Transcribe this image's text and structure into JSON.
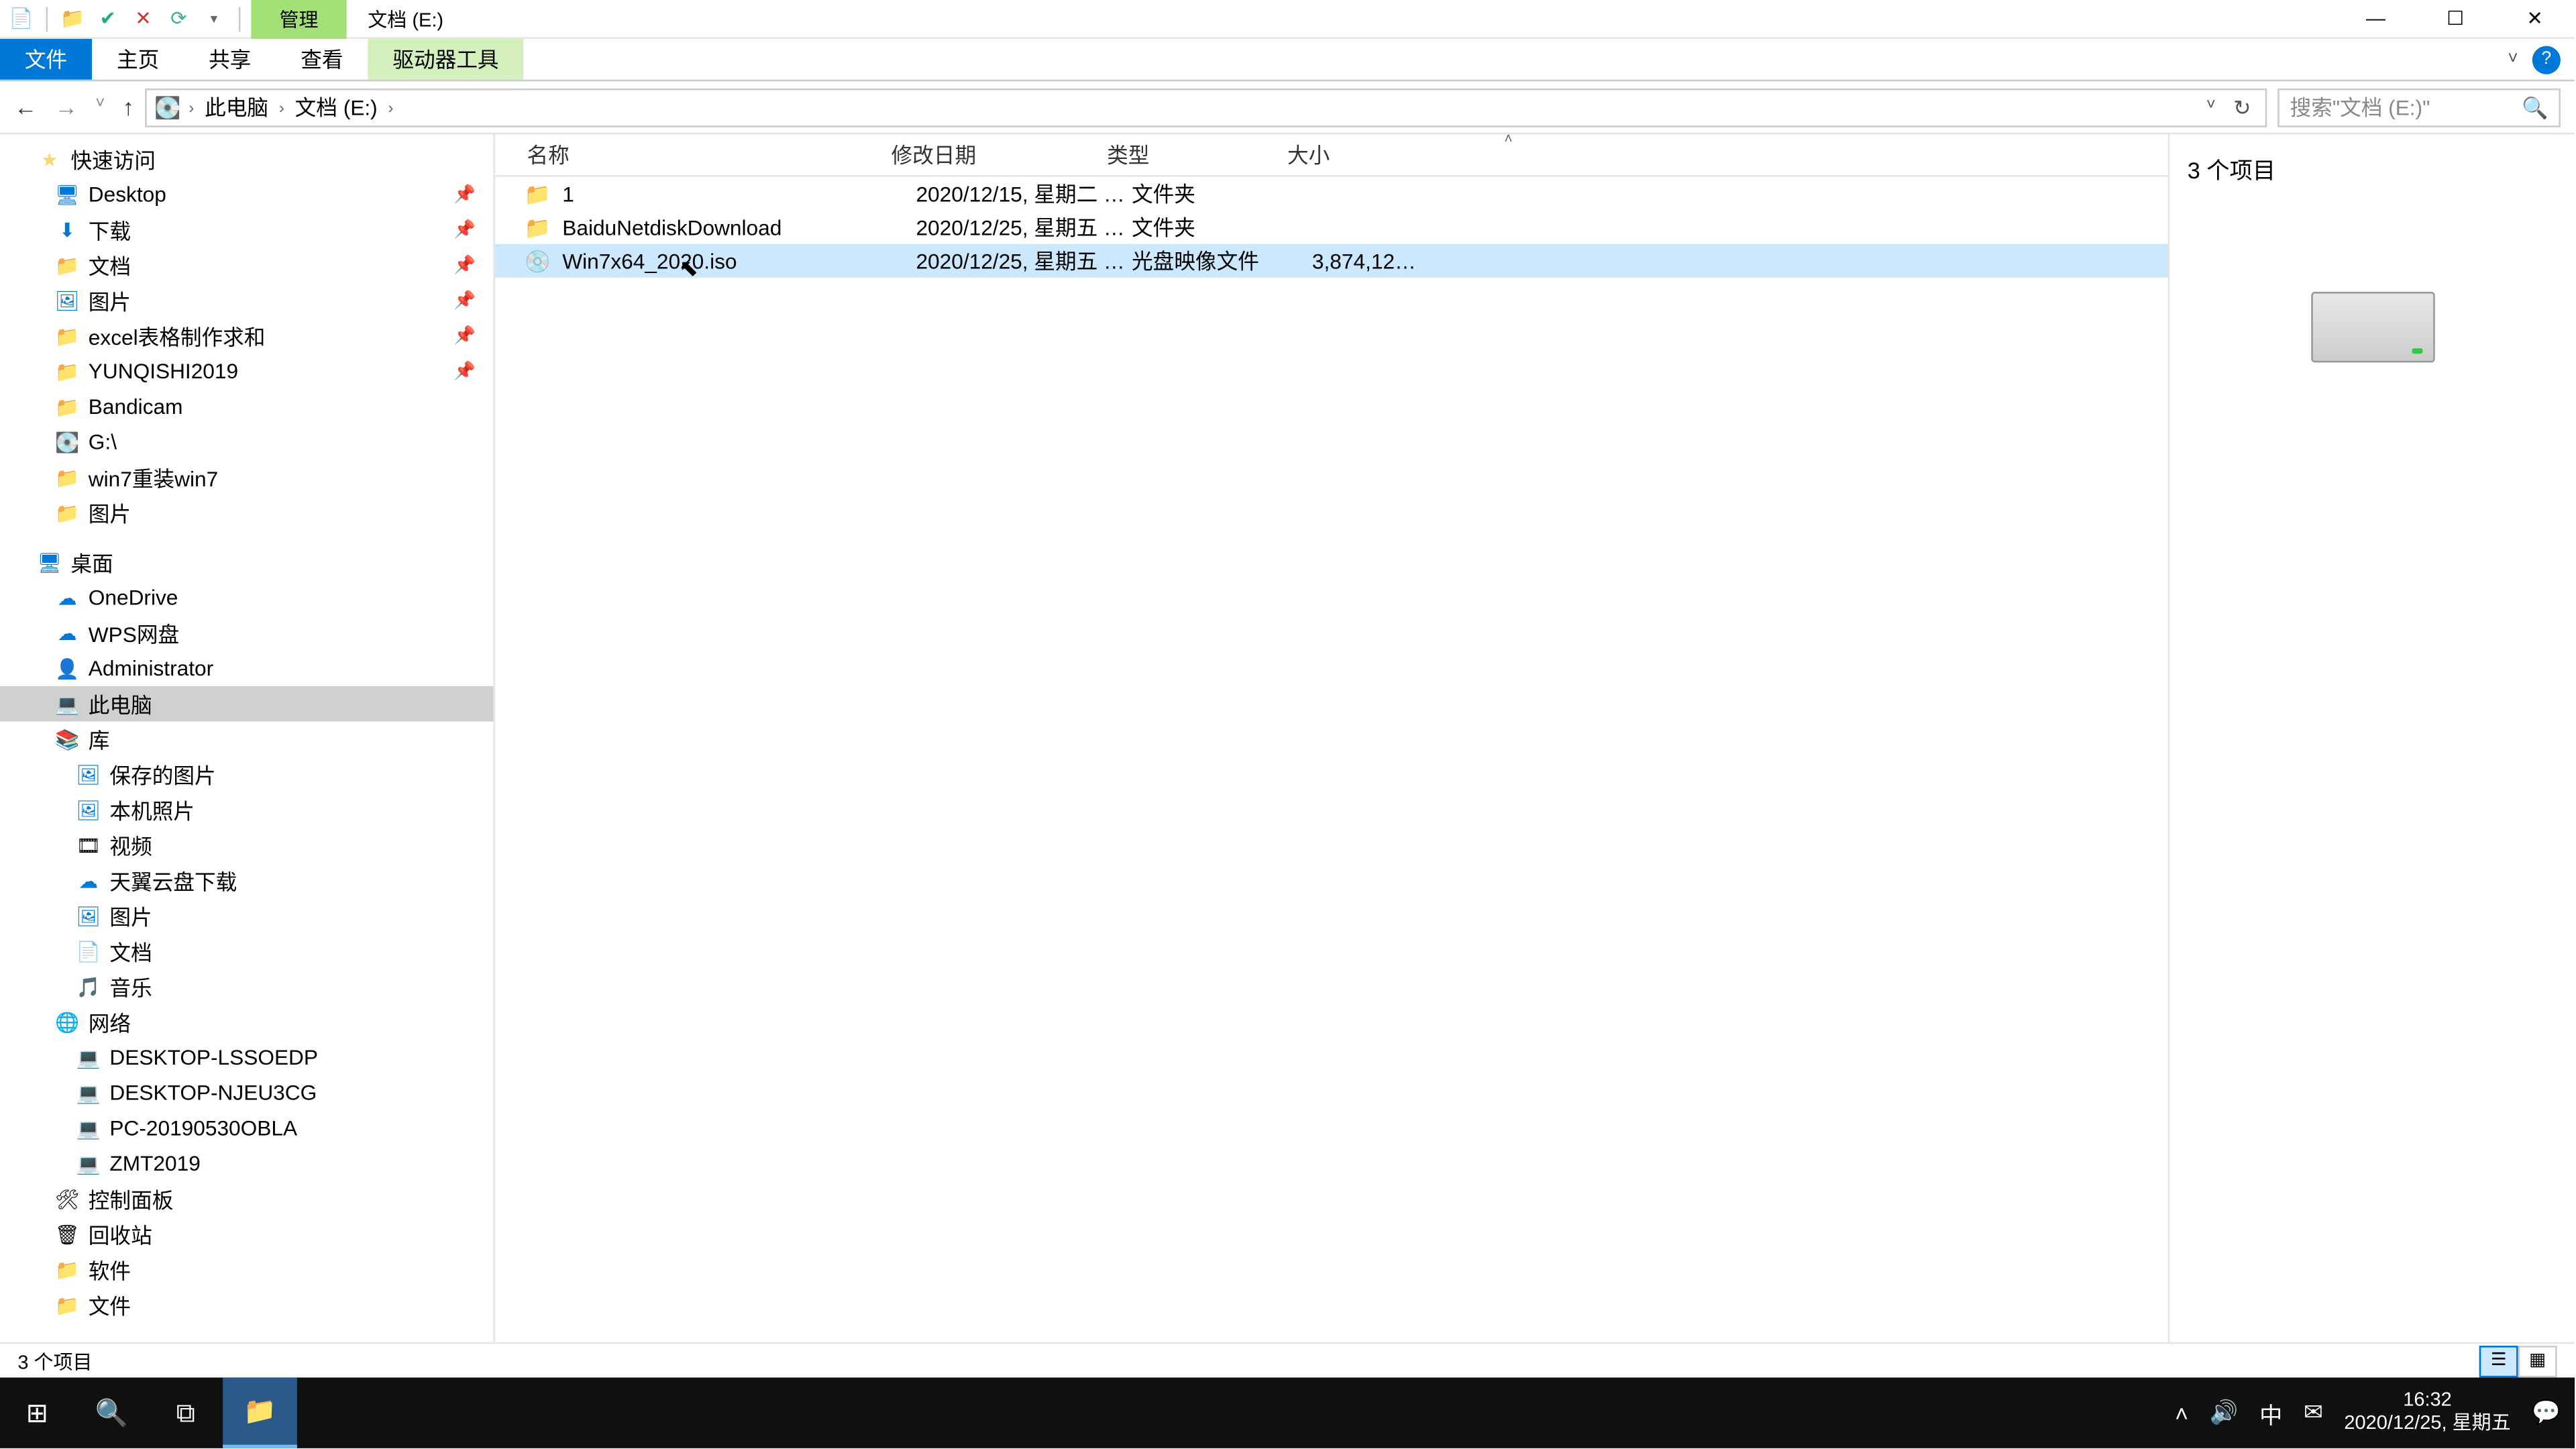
{
  "titlebar": {
    "context_tab": "管理",
    "title": "文档 (E:)"
  },
  "ribbon": {
    "file": "文件",
    "home": "主页",
    "share": "共享",
    "view": "查看",
    "drive_tools": "驱动器工具"
  },
  "breadcrumb": {
    "segments": [
      "此电脑",
      "文档 (E:)"
    ]
  },
  "search": {
    "placeholder": "搜索\"文档 (E:)\""
  },
  "nav": {
    "quick_access": "快速访问",
    "pinned": [
      {
        "icon": "blue",
        "label": "Desktop"
      },
      {
        "icon": "blue",
        "label": "下载"
      },
      {
        "icon": "folder",
        "label": "文档"
      },
      {
        "icon": "blue",
        "label": "图片"
      },
      {
        "icon": "folder",
        "label": "excel表格制作求和"
      },
      {
        "icon": "folder",
        "label": "YUNQISHI2019"
      }
    ],
    "recent": [
      {
        "icon": "folder",
        "label": "Bandicam"
      },
      {
        "icon": "drive",
        "label": "G:\\"
      },
      {
        "icon": "folder",
        "label": "win7重装win7"
      },
      {
        "icon": "folder",
        "label": "图片"
      }
    ],
    "desktop": "桌面",
    "desktop_items": [
      {
        "icon": "cloud",
        "label": "OneDrive"
      },
      {
        "icon": "cloud",
        "label": "WPS网盘"
      },
      {
        "icon": "user",
        "label": "Administrator"
      },
      {
        "icon": "pc",
        "label": "此电脑",
        "selected": true
      },
      {
        "icon": "lib",
        "label": "库"
      }
    ],
    "libraries": [
      {
        "label": "保存的图片"
      },
      {
        "label": "本机照片"
      },
      {
        "label": "视频"
      },
      {
        "label": "天翼云盘下载"
      },
      {
        "label": "图片"
      },
      {
        "label": "文档"
      },
      {
        "label": "音乐"
      }
    ],
    "network": "网络",
    "network_items": [
      "DESKTOP-LSSOEDP",
      "DESKTOP-NJEU3CG",
      "PC-20190530OBLA",
      "ZMT2019"
    ],
    "control_panel": "控制面板",
    "recycle_bin": "回收站",
    "software": "软件",
    "documents": "文件"
  },
  "columns": {
    "name": "名称",
    "date": "修改日期",
    "type": "类型",
    "size": "大小"
  },
  "files": [
    {
      "icon": "folder",
      "name": "1",
      "date": "2020/12/15, 星期二 1...",
      "type": "文件夹",
      "size": ""
    },
    {
      "icon": "folder",
      "name": "BaiduNetdiskDownload",
      "date": "2020/12/25, 星期五 1...",
      "type": "文件夹",
      "size": ""
    },
    {
      "icon": "disc",
      "name": "Win7x64_2020.iso",
      "date": "2020/12/25, 星期五 1...",
      "type": "光盘映像文件",
      "size": "3,874,126...",
      "selected": true
    }
  ],
  "preview": {
    "count_text": "3 个项目"
  },
  "statusbar": {
    "text": "3 个项目"
  },
  "taskbar": {
    "time": "16:32",
    "date": "2020/12/25, 星期五",
    "ime": "中"
  }
}
